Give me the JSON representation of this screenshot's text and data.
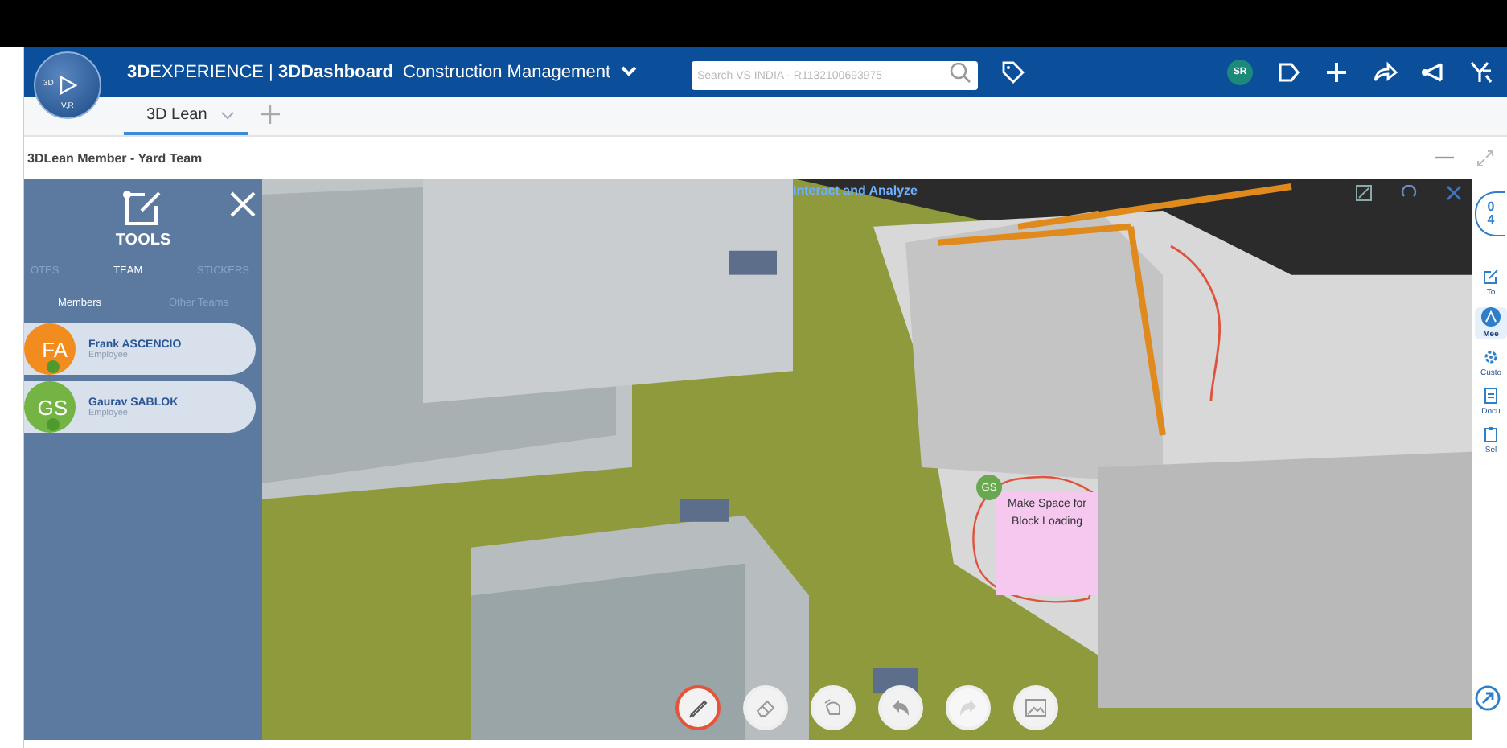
{
  "header": {
    "brand": "**3D**EXPERIENCE | **3DDashboard**",
    "dashboard": "Construction Management",
    "search": {
      "placeholder": "Search VS INDIA - R1132100693975"
    },
    "user_initials": "SR",
    "compass_labels": [
      "3D",
      "V,R"
    ]
  },
  "tabs": [
    {
      "label": "3D Lean",
      "selected": true
    }
  ],
  "widget": {
    "title": "3DLean Member - Yard Team"
  },
  "viewport": {
    "title": "Interact and Analyze"
  },
  "tools_panel": {
    "title": "TOOLS",
    "tabs": [
      {
        "label": "OTES",
        "selected": false
      },
      {
        "label": "TEAM",
        "selected": true
      },
      {
        "label": "STICKERS",
        "selected": false
      }
    ],
    "subtabs": [
      {
        "label": "Members",
        "selected": true
      },
      {
        "label": "Other Teams",
        "selected": false
      }
    ],
    "members": [
      {
        "initials": "FA",
        "name": "Frank ASCENCIO",
        "role": "Employee",
        "color": "#f28c1e"
      },
      {
        "initials": "GS",
        "name": "Gaurav SABLOK",
        "role": "Employee",
        "color": "#74b444"
      }
    ]
  },
  "sticky_note": {
    "initials": "GS",
    "text": "Make Space for Block Loading"
  },
  "drawing_tools": [
    {
      "kind": "pen",
      "selected": true,
      "disabled": false
    },
    {
      "kind": "eraser",
      "selected": false,
      "disabled": false
    },
    {
      "kind": "hand",
      "selected": false,
      "disabled": false
    },
    {
      "kind": "undo",
      "selected": false,
      "disabled": false
    },
    {
      "kind": "redo",
      "selected": false,
      "disabled": true
    },
    {
      "kind": "image",
      "selected": false,
      "disabled": false
    }
  ],
  "right_sidebar": {
    "counter": [
      "0",
      "4"
    ],
    "items": [
      {
        "kind": "tools",
        "label": "To",
        "selected": false
      },
      {
        "kind": "meeting",
        "label": "Mee",
        "selected": true
      },
      {
        "kind": "custom",
        "label": "Custo",
        "selected": false
      },
      {
        "kind": "document",
        "label": "Docu",
        "selected": false
      },
      {
        "kind": "select",
        "label": "Sel",
        "selected": false
      }
    ]
  }
}
